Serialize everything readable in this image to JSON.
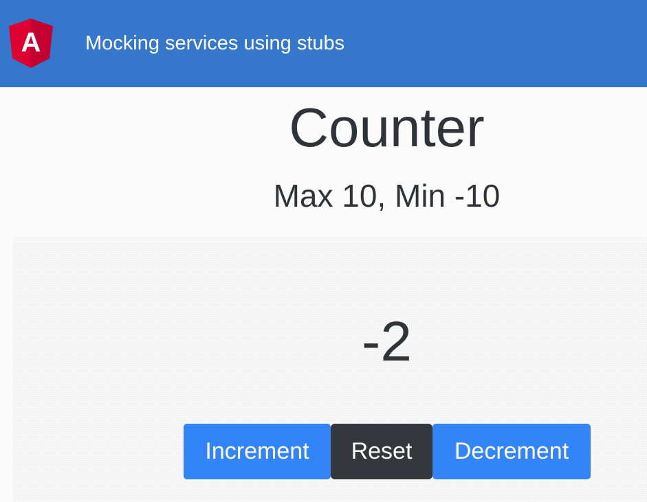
{
  "navbar": {
    "logo_icon": "angular-logo-icon",
    "logo_letter": "A",
    "title": "Mocking services using stubs",
    "background_color": "#3477cc"
  },
  "counter": {
    "heading": "Counter",
    "limits": "Max 10, Min -10",
    "value": "-2"
  },
  "buttons": {
    "increment_label": "Increment",
    "reset_label": "Reset",
    "decrement_label": "Decrement"
  },
  "colors": {
    "primary": "#3384f6",
    "dark": "#34373b",
    "angular_red": "#dd0031",
    "angular_dark_red": "#c3002f"
  }
}
